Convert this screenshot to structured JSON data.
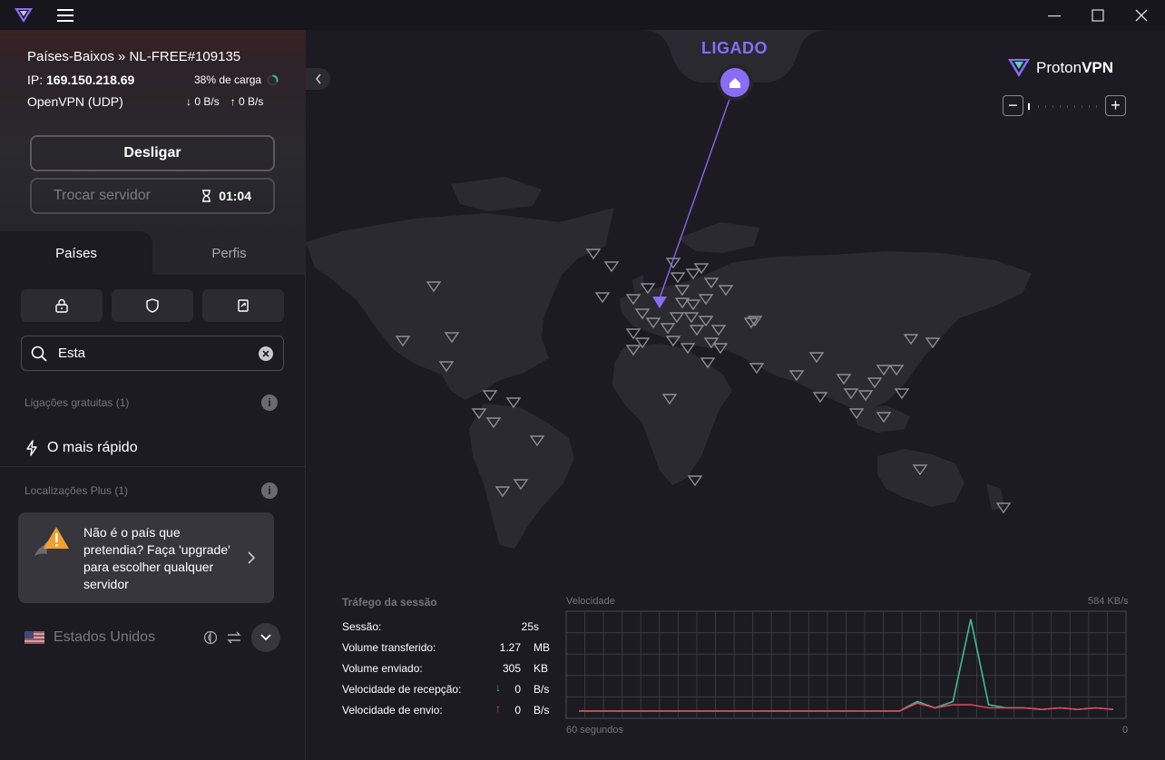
{
  "connection": {
    "server": "Países-Baixos » NL-FREE#109135",
    "ip_label": "IP:",
    "ip": "169.150.218.69",
    "load": "38% de carga",
    "protocol": "OpenVPN (UDP)",
    "download": "0 B/s",
    "upload": "0 B/s",
    "disconnect_label": "Desligar",
    "change_server_label": "Trocar servidor",
    "timer": "01:04"
  },
  "tabs": {
    "countries": "Países",
    "profiles": "Perfis"
  },
  "search": {
    "value": "Esta"
  },
  "free_section": {
    "title": "Ligações gratuitas (1)",
    "fastest": "O mais rápido"
  },
  "plus_section": {
    "title": "Localizações Plus (1)",
    "upgrade_text": "Não é o país que pretendia? Faça 'upgrade' para escolher qualquer servidor",
    "country": "Estados Unidos"
  },
  "map": {
    "status": "LIGADO",
    "brand": "ProtonVPN",
    "brand_a": "Proton",
    "brand_b": "VPN"
  },
  "session": {
    "title": "Tráfego da sessão",
    "rows": [
      {
        "label": "Sessão:",
        "value": "25s",
        "unit": ""
      },
      {
        "label": "Volume transferido:",
        "value": "1.27",
        "unit": "MB"
      },
      {
        "label": "Volume enviado:",
        "value": "305",
        "unit": "KB"
      },
      {
        "label": "Velocidade de recepção:",
        "value": "0",
        "unit": "B/s"
      },
      {
        "label": "Velocidade de envio:",
        "value": "0",
        "unit": "B/s"
      }
    ]
  },
  "speed_chart": {
    "title": "Velocidade",
    "max_label": "584 KB/s",
    "x_start": "60 segundos",
    "x_end": "0"
  },
  "chart_data": {
    "type": "line",
    "title": "Velocidade",
    "xlabel": "",
    "ylabel": "",
    "x": [
      60,
      58,
      56,
      54,
      52,
      50,
      48,
      46,
      44,
      42,
      40,
      38,
      36,
      34,
      32,
      30,
      28,
      26,
      24,
      22,
      20,
      18,
      16,
      14,
      12,
      10,
      8,
      6,
      4,
      2,
      0
    ],
    "ylim": [
      0,
      584
    ],
    "series": [
      {
        "color": "#3dbd8f",
        "values": [
          0,
          0,
          0,
          0,
          0,
          0,
          0,
          0,
          0,
          0,
          0,
          0,
          0,
          0,
          0,
          0,
          0,
          0,
          0,
          60,
          20,
          60,
          580,
          40,
          20,
          20,
          10,
          20,
          10,
          20,
          10
        ]
      },
      {
        "color": "#e0455f",
        "values": [
          0,
          0,
          0,
          0,
          0,
          0,
          0,
          0,
          0,
          0,
          0,
          0,
          0,
          0,
          0,
          0,
          0,
          0,
          0,
          50,
          20,
          40,
          40,
          20,
          20,
          20,
          10,
          20,
          10,
          20,
          10
        ]
      }
    ]
  },
  "colors": {
    "accent": "#8b6cf5",
    "download": "#3dbd8f",
    "upload": "#e0455f"
  }
}
